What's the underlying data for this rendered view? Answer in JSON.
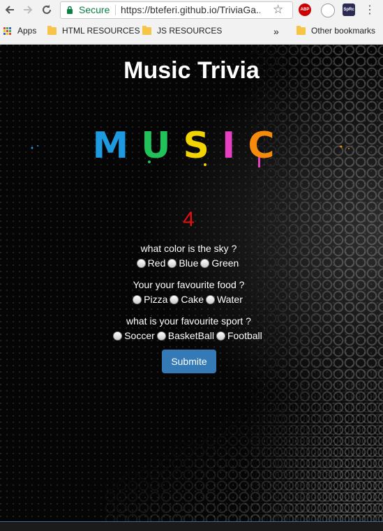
{
  "browser": {
    "secure_label": "Secure",
    "url": "https://bteferi.github.io/TriviaGa...",
    "bookmarks": [
      "Apps",
      "HTML RESOURCES",
      "JS RESOURCES",
      "Other bookmarks"
    ],
    "overflow": "»",
    "extensions": [
      "ABP",
      "SpRc"
    ]
  },
  "page": {
    "title": "Music Trivia",
    "logo_text": "MUSIC",
    "counter": "4",
    "questions": [
      {
        "text": "what color is the sky ?",
        "options": [
          "Red",
          "Blue",
          "Green"
        ]
      },
      {
        "text": "Your your favourite food ?",
        "options": [
          "Pizza",
          "Cake",
          "Water"
        ]
      },
      {
        "text": "what is your favourite sport ?",
        "options": [
          "Soccer",
          "BasketBall",
          "Football"
        ]
      }
    ],
    "submit_label": "Submite"
  },
  "colors": {
    "counter": "#e01010",
    "submit_bg": "#337ab7",
    "logo": [
      "#1e9be0",
      "#22c25a",
      "#f2d400",
      "#e63fbf",
      "#f58a0b"
    ]
  }
}
